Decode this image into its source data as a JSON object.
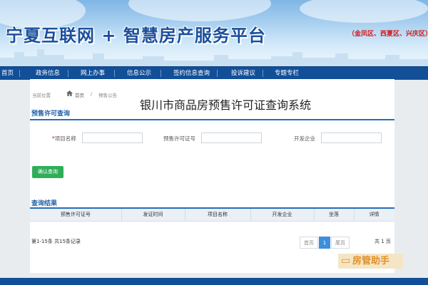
{
  "banner": {
    "title": "宁夏互联网 + 智慧房产服务平台",
    "districts": "（金凤区、西夏区、兴庆区）"
  },
  "nav": {
    "items": [
      "首页",
      "政务信息",
      "网上办事",
      "信息公示",
      "签约信息查询",
      "投诉建议",
      "专题专栏"
    ]
  },
  "breadcrumb": {
    "current_label": "当前位置",
    "home": "首页",
    "page": "预售公告"
  },
  "main": {
    "system_title": "银川市商品房预售许可证查询系统",
    "query_section_title": "预售许可查询",
    "fields": {
      "project_name_label": "项目名称",
      "project_name_required": "*",
      "project_name_value": "",
      "permit_no_label": "预售许可证号",
      "permit_no_value": "",
      "developer_label": "开发企业",
      "developer_value": ""
    },
    "query_button": "确认查询",
    "results_section_title": "查询结果",
    "table": {
      "columns": [
        "预售许可证号",
        "发证时间",
        "项目名称",
        "开发企业",
        "坐落",
        "详情"
      ]
    },
    "summary": "第1-15条  共15条记录",
    "pagination": {
      "first": "首页",
      "current": "1",
      "last": "尾页",
      "page_count": "共  1  页"
    }
  },
  "watermark": {
    "text": "房管助手",
    "icon": "chat-bubble-icon"
  },
  "colors": {
    "nav_bg": "#124f99",
    "accent_blue": "#1f5fa6",
    "button_green": "#2fae5a",
    "active_page": "#3d8fd9",
    "district_red": "#d41b1b"
  }
}
